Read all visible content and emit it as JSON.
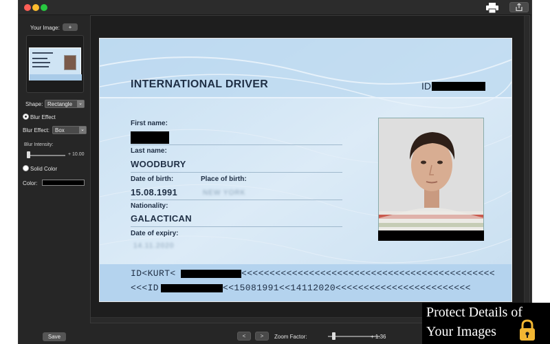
{
  "sidebar": {
    "your_image_label": "Your Image:",
    "add_label": "+",
    "shape_label": "Shape:",
    "shape_value": "Rectangle",
    "blur_effect_radio": "Blur Effect",
    "blur_effect_label": "Blur Effect:",
    "blur_effect_value": "Box",
    "blur_intensity_label": "Blur Intensity:",
    "blur_intensity_value": "+ 10.00",
    "solid_color_radio": "Solid Color",
    "color_label": "Color:",
    "color_value": "#000000",
    "save_label": "Save"
  },
  "bottombar": {
    "prev_label": "<",
    "next_label": ">",
    "zoom_label": "Zoom Factor:",
    "zoom_value": "+ 1.36"
  },
  "card": {
    "heading": "INTERNATIONAL DRIVER",
    "id_label": "ID",
    "first_name_label": "First name:",
    "last_name_label": "Last name:",
    "last_name_value": "WOODBURY",
    "dob_label": "Date of birth:",
    "dob_value": "15.08.1991",
    "pob_label": "Place of birth:",
    "pob_value": "NEW YORK",
    "nationality_label": "Nationality:",
    "nationality_value": "GALACTICAN",
    "expiry_label": "Date of expiry:",
    "expiry_value": "14.11.2020",
    "mrz_line1_prefix": "ID<KURT<",
    "mrz_line1_suffix": "<<<<<<<<<<<<<<<<<<<<<<<<<<<<<<<<<<<<<<<<<<<<<",
    "mrz_line2_prefix": "<<<ID",
    "mrz_line2_suffix": "<<15081991<<14112020<<<<<<<<<<<<<<<<<<<<<<<<"
  },
  "overlay": {
    "line1": "Protect Details of",
    "line2": "Your Images"
  },
  "icons": [
    "print-icon",
    "share-icon",
    "lock-icon"
  ]
}
